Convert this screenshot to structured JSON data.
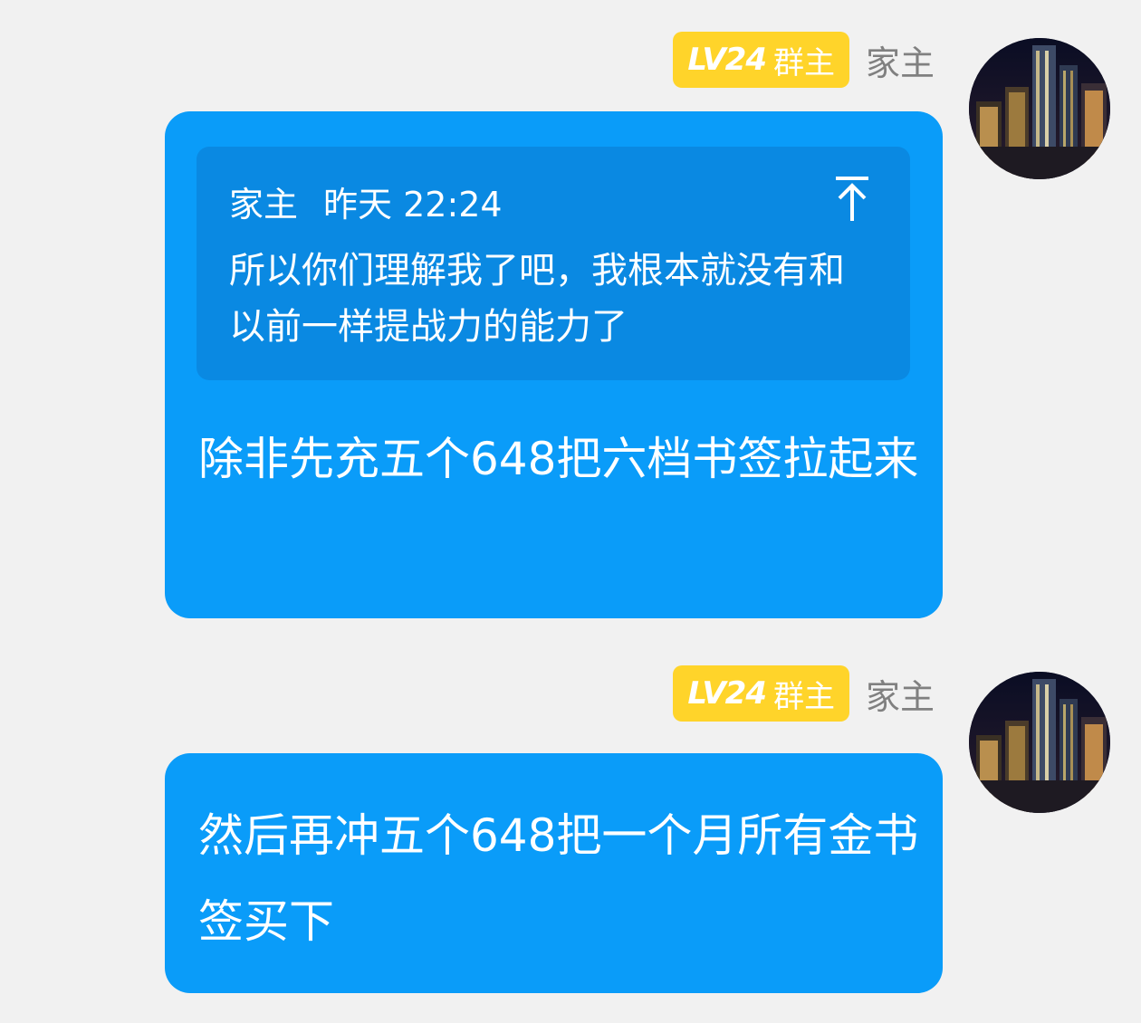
{
  "colors": {
    "background": "#f1f1f1",
    "bubble": "#0a9cf9",
    "quote_box": "#0a89e2",
    "badge": "#ffd42a",
    "name_text": "#808080"
  },
  "messages": [
    {
      "sender": {
        "level": "LV24",
        "role": "群主",
        "name": "家主",
        "avatar_icon": "city-night-skyline-avatar"
      },
      "quote": {
        "author": "家主",
        "time": "昨天 22:24",
        "jump_icon": "arrow-up-icon",
        "text": "所以你们理解我了吧，我根本就没有和以前一样提战力的能力了"
      },
      "text": "除非先充五个648把六档书签拉起来"
    },
    {
      "sender": {
        "level": "LV24",
        "role": "群主",
        "name": "家主",
        "avatar_icon": "city-night-skyline-avatar"
      },
      "text": "然后再冲五个648把一个月所有金书签买下"
    }
  ]
}
